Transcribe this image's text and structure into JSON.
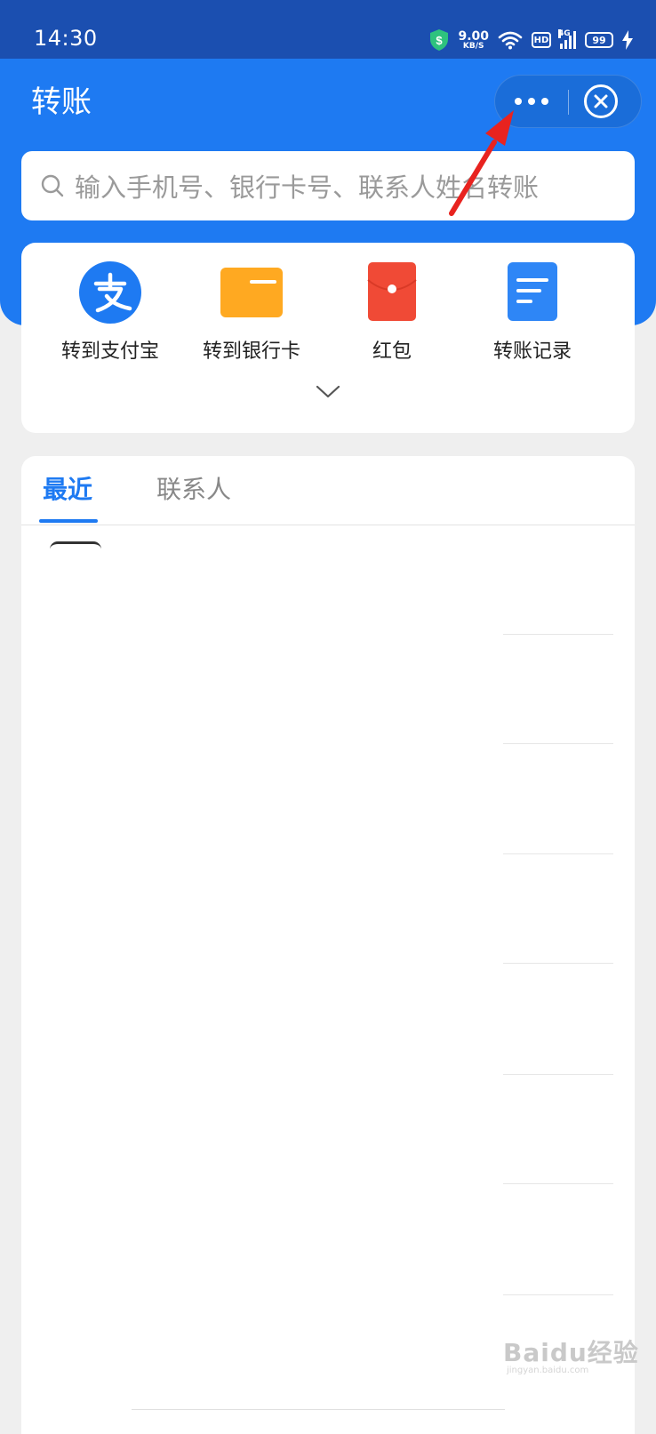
{
  "status_bar": {
    "time": "14:30",
    "net_speed": "9.00",
    "net_unit": "KB/S",
    "hd": "HD",
    "network": "4G",
    "battery": "99"
  },
  "header": {
    "title": "转账",
    "more_icon": "more-dots-icon",
    "close_icon": "close-circle-icon"
  },
  "search": {
    "placeholder": "输入手机号、银行卡号、联系人姓名转账"
  },
  "quick_actions": [
    {
      "label": "转到支付宝",
      "icon": "alipay-icon",
      "color": "#1e7af2"
    },
    {
      "label": "转到银行卡",
      "icon": "bank-card-icon",
      "color": "#ffa921"
    },
    {
      "label": "红包",
      "icon": "red-envelope-icon",
      "color": "#f04a36"
    },
    {
      "label": "转账记录",
      "icon": "records-icon",
      "color": "#2e86f6"
    }
  ],
  "tabs": [
    {
      "label": "最近",
      "active": true
    },
    {
      "label": "联系人",
      "active": false
    }
  ],
  "watermark": {
    "text": "Baidu经验",
    "sub": "jingyan.baidu.com"
  },
  "colors": {
    "primary": "#1e7af2",
    "status_bar": "#1b4fb0",
    "annotation_arrow": "#e8231f"
  }
}
